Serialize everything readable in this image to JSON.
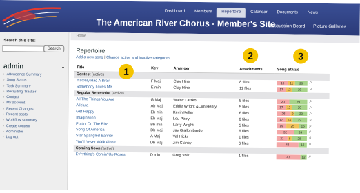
{
  "header": {
    "site_title": "The American River Chorus - Member's Site",
    "nav": [
      "Dashboard",
      "Members",
      "Repertoire",
      "Calendar",
      "Documents",
      "News"
    ],
    "nav_selected": "Repertoire",
    "subnav": [
      "Discussion Board",
      "Picture Galleries"
    ]
  },
  "sidebar": {
    "search_label": "Search this site:",
    "search_value": "",
    "search_button": "Search",
    "admin_title": "admin",
    "items": [
      "Attendance Summary",
      "Song Status",
      "Task Summary",
      "Recruiting Tracker",
      "Contact",
      "My account",
      "Recent Changes",
      "Recent posts",
      "Workflow summary",
      "Create content",
      "Administer",
      "Log out"
    ]
  },
  "breadcrumb": "Home",
  "page": {
    "title": "Repertoire",
    "actions": [
      "Add a new song",
      "Change active and inactive categories"
    ],
    "separator": "|"
  },
  "table": {
    "headers": [
      "Title",
      "Key",
      "Arranger",
      "Attachments",
      "Song Status"
    ],
    "rows": [
      {
        "type": "group",
        "name": "Contest",
        "status": "(active)"
      },
      {
        "type": "song",
        "title": "If I Only Had A Brain",
        "key": "F Maj",
        "arranger": "Clay Hine",
        "attachments": "8 files",
        "status": [
          "18",
          "11",
          "20"
        ]
      },
      {
        "type": "song",
        "title": "Somebody Loves Me",
        "key": "E min",
        "arranger": "Clay Hine",
        "attachments": "11 files",
        "status": [
          "17",
          "12",
          "29"
        ]
      },
      {
        "type": "group",
        "name": "Regular Repertoire",
        "status": "(active)"
      },
      {
        "type": "song",
        "title": "All The Things You Are",
        "key": "G Maj",
        "arranger": "Walter Latzko",
        "attachments": "5 files",
        "status": [
          "20",
          "29"
        ]
      },
      {
        "type": "song",
        "title": "Alleluia",
        "key": "Ab Maj",
        "arranger": "Eddie Wright & Jim Henry",
        "attachments": "5 files",
        "status": [
          "17",
          "12",
          "29"
        ]
      },
      {
        "type": "song",
        "title": "Get Happy",
        "key": "Eb min",
        "arranger": "Kevin Keller",
        "attachments": "6 files",
        "status": [
          "26",
          "9",
          "23"
        ]
      },
      {
        "type": "song",
        "title": "Imagination",
        "key": "Eb Maj",
        "arranger": "Lou Perry",
        "attachments": "6 files",
        "status": [
          "17",
          "13",
          "27"
        ]
      },
      {
        "type": "song",
        "title": "Puttin' On The Ritz",
        "key": "Bb min",
        "arranger": "Larry Wright",
        "attachments": "5 files",
        "status": [
          "19",
          "25",
          "16"
        ]
      },
      {
        "type": "song",
        "title": "Song Of America",
        "key": "Db Maj",
        "arranger": "Jay Giallombardo",
        "attachments": "6 files",
        "status": [
          "32",
          "24"
        ]
      },
      {
        "type": "song",
        "title": "Star Spangled Banner",
        "key": "A Maj",
        "arranger": "Val Hicks",
        "attachments": "1 files",
        "status": [
          "21",
          "8",
          "28"
        ]
      },
      {
        "type": "song",
        "title": "You'll Never Walk Alone",
        "key": "Db Maj",
        "arranger": "Jim Clancy",
        "attachments": "6 files",
        "status": [
          "43",
          "16"
        ]
      },
      {
        "type": "group",
        "name": "Coming Soon",
        "status": "(active)"
      },
      {
        "type": "song",
        "title": "Ev'rything's Comin' Up Roses",
        "key": "D min",
        "arranger": "Greg Volk",
        "attachments": "1 files",
        "status": [
          "47",
          "12"
        ]
      }
    ]
  },
  "callouts": [
    "1",
    "2",
    "3"
  ],
  "colors": {
    "header_blue": "#2b3a78",
    "link_blue": "#2a5d9b",
    "status_red": "#f4a7a7",
    "status_orange": "#f1c35a",
    "status_green": "#a8d48a",
    "callout_yellow": "#f5c400"
  }
}
